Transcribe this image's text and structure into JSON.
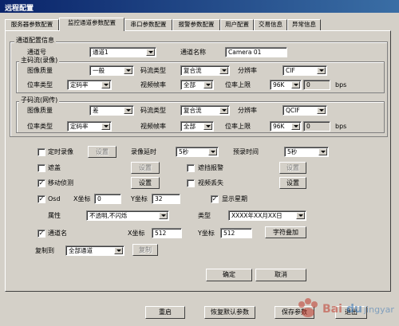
{
  "window": {
    "title": "远程配置"
  },
  "tabs": [
    {
      "label": "服务器参数配置"
    },
    {
      "label": "监控通道参数配置"
    },
    {
      "label": "串口参数配置"
    },
    {
      "label": "报警参数配置"
    },
    {
      "label": "用户配置"
    },
    {
      "label": "交易信息"
    },
    {
      "label": "异常信息"
    }
  ],
  "channel_group": {
    "title": "通道配置信息"
  },
  "channel": {
    "no_label": "通道号",
    "no_value": "通道1",
    "name_label": "通道名称",
    "name_value": "Camera 01"
  },
  "main_stream": {
    "title": "主码流(录像)",
    "quality_label": "图像质量",
    "quality_value": "一般",
    "stream_type_label": "码流类型",
    "stream_type_value": "复合流",
    "resolution_label": "分辨率",
    "resolution_value": "CIF",
    "rate_type_label": "位率类型",
    "rate_type_value": "定码率",
    "fps_label": "视频帧率",
    "fps_value": "全部",
    "rate_limit_label": "位率上限",
    "rate_limit_value": "96K",
    "rate_limit_input": "0",
    "unit": "bps"
  },
  "sub_stream": {
    "title": "子码流(网传)",
    "quality_label": "图像质量",
    "quality_value": "差",
    "stream_type_label": "码流类型",
    "stream_type_value": "复合流",
    "resolution_label": "分辨率",
    "resolution_value": "QCIF",
    "rate_type_label": "位率类型",
    "rate_type_value": "定码率",
    "fps_label": "视频帧率",
    "fps_value": "全部",
    "rate_limit_label": "位率上限",
    "rate_limit_value": "96K",
    "rate_limit_input": "0",
    "unit": "bps"
  },
  "record": {
    "timed_label": "定时录像",
    "timed_checked": false,
    "set_label": "设置",
    "delay_label": "录像延时",
    "delay_value": "5秒",
    "pre_label": "预录时间",
    "pre_value": "5秒"
  },
  "mask": {
    "label": "遮盖",
    "checked": false,
    "set_label": "设置"
  },
  "mask_alarm": {
    "label": "遮挡报警",
    "checked": false,
    "set_label": "设置"
  },
  "motion": {
    "label": "移动侦测",
    "checked": true,
    "set_label": "设置"
  },
  "video_loss": {
    "label": "视频丢失",
    "checked": false,
    "set_label": "设置"
  },
  "osd": {
    "label": "Osd",
    "checked": true,
    "x_label": "X坐标",
    "x_value": "0",
    "y_label": "Y坐标",
    "y_value": "32",
    "show_week_label": "显示星期",
    "show_week_checked": true,
    "attr_label": "属性",
    "attr_value": "不透明,不闪烁",
    "type_label": "类型",
    "type_value": "XXXX年XX月XX日"
  },
  "channel_name_osd": {
    "label": "通道名",
    "checked": true,
    "x_label": "X坐标",
    "x_value": "512",
    "y_label": "Y坐标",
    "y_value": "512",
    "overlay_label": "字符叠加"
  },
  "copy": {
    "label": "复制到",
    "value": "全部通道",
    "button": "复制"
  },
  "dialog": {
    "ok": "确定",
    "cancel": "取消"
  },
  "footer": {
    "restart": "重启",
    "restore": "恢复默认参数",
    "save": "保存参数",
    "exit": "退出"
  }
}
